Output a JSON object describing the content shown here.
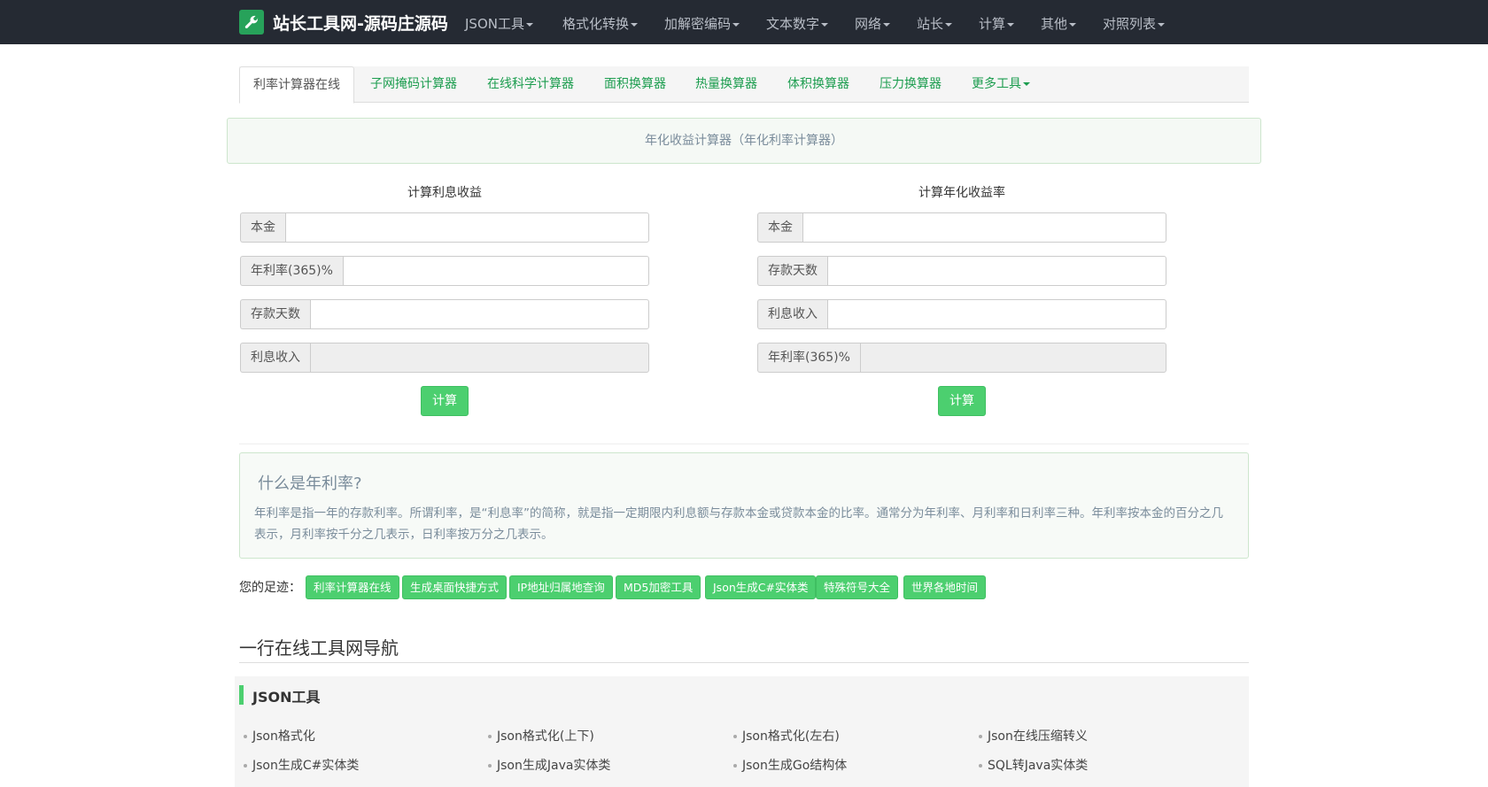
{
  "header": {
    "brand": "站长工具网-源码庄源码",
    "menu": [
      "JSON工具",
      "格式化转换",
      "加解密编码",
      "文本数字",
      "网络",
      "站长",
      "计算",
      "其他",
      "对照列表"
    ]
  },
  "tabs": [
    "利率计算器在线",
    "子网掩码计算器",
    "在线科学计算器",
    "面积换算器",
    "热量换算器",
    "体积换算器",
    "压力换算器",
    "更多工具"
  ],
  "alert": "年化收益计算器（年化利率计算器）",
  "calc_left": {
    "title": "计算利息收益",
    "fields": [
      "本金",
      "年利率(365)%",
      "存款天数",
      "利息收入"
    ],
    "button": "计算"
  },
  "calc_right": {
    "title": "计算年化收益率",
    "fields": [
      "本金",
      "存款天数",
      "利息收入",
      "年利率(365)%"
    ],
    "button": "计算"
  },
  "info": {
    "title": "什么是年利率?",
    "text": "年利率是指一年的存款利率。所谓利率，是“利息率”的简称，就是指一定期限内利息额与存款本金或贷款本金的比率。通常分为年利率、月利率和日利率三种。年利率按本金的百分之几表示，月利率按千分之几表示，日利率按万分之几表示。"
  },
  "footprints": {
    "label": "您的足迹：",
    "items": [
      "利率计算器在线",
      "生成桌面快捷方式",
      "IP地址归属地查询",
      "MD5加密工具",
      "Json生成C#实体类",
      "特殊符号大全",
      "世界各地时间"
    ]
  },
  "nav_section": {
    "heading": "一行在线工具网导航",
    "category": "JSON工具",
    "links": [
      "Json格式化",
      "Json格式化(上下)",
      "Json格式化(左右)",
      "Json在线压缩转义",
      "Json生成C#实体类",
      "Json生成Java实体类",
      "Json生成Go结构体",
      "SQL转Java实体类"
    ]
  },
  "colors": {
    "navbar": "#252a33",
    "accent": "#4ccf6f",
    "link": "#1c9d4f"
  },
  "icons": {
    "brand": "wrench-icon"
  }
}
